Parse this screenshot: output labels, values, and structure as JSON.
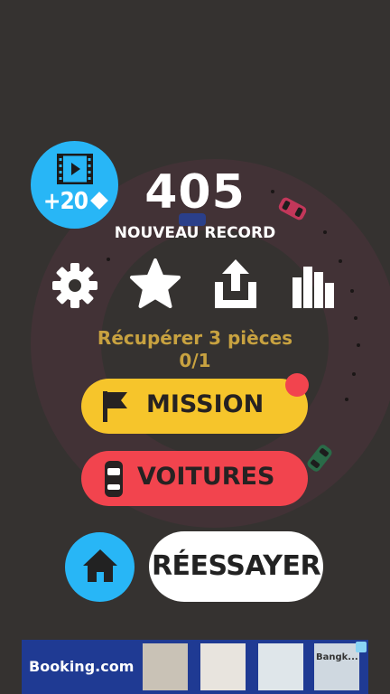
{
  "video_reward": {
    "amount": "+20",
    "icon": "film-icon",
    "currency_icon": "diamond-icon"
  },
  "score": "405",
  "record_label": "NOUVEAU RECORD",
  "icons": [
    "gear-icon",
    "star-icon",
    "share-icon",
    "leaderboard-icon"
  ],
  "mission": {
    "description": "Récupérer 3 pièces",
    "progress": "0/1"
  },
  "buttons": {
    "mission": "MISSION",
    "cars": "VOITURES",
    "retry": "RÉESSAYER",
    "home_icon": "home-icon"
  },
  "ad": {
    "brand": "Booking.com",
    "thumb_text": "Bangk..."
  },
  "colors": {
    "background": "#353230",
    "track": "#423236",
    "blue": "#28b6f6",
    "yellow": "#f6c52b",
    "red": "#f2444e",
    "mission_text": "#c8a240"
  }
}
